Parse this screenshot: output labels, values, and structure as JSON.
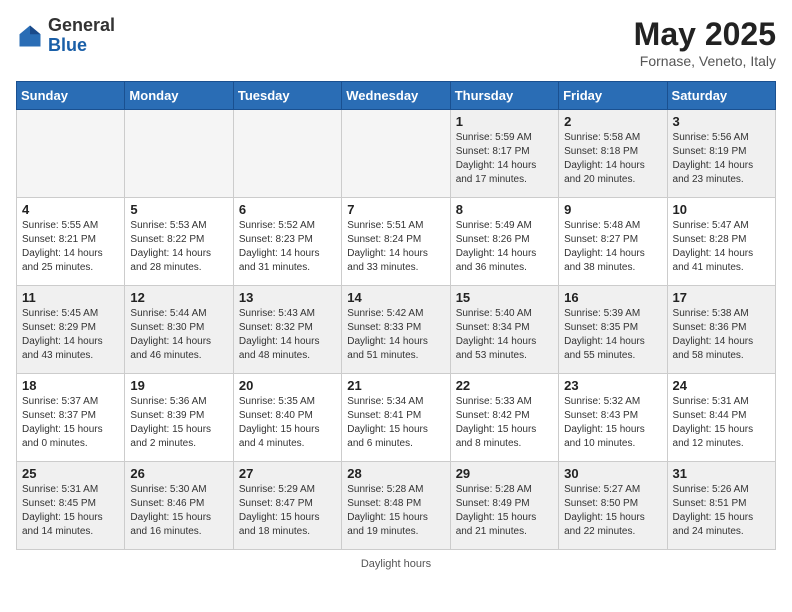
{
  "header": {
    "logo_line1": "General",
    "logo_line2": "Blue",
    "month": "May 2025",
    "location": "Fornase, Veneto, Italy"
  },
  "days_of_week": [
    "Sunday",
    "Monday",
    "Tuesday",
    "Wednesday",
    "Thursday",
    "Friday",
    "Saturday"
  ],
  "weeks": [
    [
      {
        "day": "",
        "info": "",
        "empty": true
      },
      {
        "day": "",
        "info": "",
        "empty": true
      },
      {
        "day": "",
        "info": "",
        "empty": true
      },
      {
        "day": "",
        "info": "",
        "empty": true
      },
      {
        "day": "1",
        "info": "Sunrise: 5:59 AM\nSunset: 8:17 PM\nDaylight: 14 hours\nand 17 minutes."
      },
      {
        "day": "2",
        "info": "Sunrise: 5:58 AM\nSunset: 8:18 PM\nDaylight: 14 hours\nand 20 minutes."
      },
      {
        "day": "3",
        "info": "Sunrise: 5:56 AM\nSunset: 8:19 PM\nDaylight: 14 hours\nand 23 minutes."
      }
    ],
    [
      {
        "day": "4",
        "info": "Sunrise: 5:55 AM\nSunset: 8:21 PM\nDaylight: 14 hours\nand 25 minutes."
      },
      {
        "day": "5",
        "info": "Sunrise: 5:53 AM\nSunset: 8:22 PM\nDaylight: 14 hours\nand 28 minutes."
      },
      {
        "day": "6",
        "info": "Sunrise: 5:52 AM\nSunset: 8:23 PM\nDaylight: 14 hours\nand 31 minutes."
      },
      {
        "day": "7",
        "info": "Sunrise: 5:51 AM\nSunset: 8:24 PM\nDaylight: 14 hours\nand 33 minutes."
      },
      {
        "day": "8",
        "info": "Sunrise: 5:49 AM\nSunset: 8:26 PM\nDaylight: 14 hours\nand 36 minutes."
      },
      {
        "day": "9",
        "info": "Sunrise: 5:48 AM\nSunset: 8:27 PM\nDaylight: 14 hours\nand 38 minutes."
      },
      {
        "day": "10",
        "info": "Sunrise: 5:47 AM\nSunset: 8:28 PM\nDaylight: 14 hours\nand 41 minutes."
      }
    ],
    [
      {
        "day": "11",
        "info": "Sunrise: 5:45 AM\nSunset: 8:29 PM\nDaylight: 14 hours\nand 43 minutes."
      },
      {
        "day": "12",
        "info": "Sunrise: 5:44 AM\nSunset: 8:30 PM\nDaylight: 14 hours\nand 46 minutes."
      },
      {
        "day": "13",
        "info": "Sunrise: 5:43 AM\nSunset: 8:32 PM\nDaylight: 14 hours\nand 48 minutes."
      },
      {
        "day": "14",
        "info": "Sunrise: 5:42 AM\nSunset: 8:33 PM\nDaylight: 14 hours\nand 51 minutes."
      },
      {
        "day": "15",
        "info": "Sunrise: 5:40 AM\nSunset: 8:34 PM\nDaylight: 14 hours\nand 53 minutes."
      },
      {
        "day": "16",
        "info": "Sunrise: 5:39 AM\nSunset: 8:35 PM\nDaylight: 14 hours\nand 55 minutes."
      },
      {
        "day": "17",
        "info": "Sunrise: 5:38 AM\nSunset: 8:36 PM\nDaylight: 14 hours\nand 58 minutes."
      }
    ],
    [
      {
        "day": "18",
        "info": "Sunrise: 5:37 AM\nSunset: 8:37 PM\nDaylight: 15 hours\nand 0 minutes."
      },
      {
        "day": "19",
        "info": "Sunrise: 5:36 AM\nSunset: 8:39 PM\nDaylight: 15 hours\nand 2 minutes."
      },
      {
        "day": "20",
        "info": "Sunrise: 5:35 AM\nSunset: 8:40 PM\nDaylight: 15 hours\nand 4 minutes."
      },
      {
        "day": "21",
        "info": "Sunrise: 5:34 AM\nSunset: 8:41 PM\nDaylight: 15 hours\nand 6 minutes."
      },
      {
        "day": "22",
        "info": "Sunrise: 5:33 AM\nSunset: 8:42 PM\nDaylight: 15 hours\nand 8 minutes."
      },
      {
        "day": "23",
        "info": "Sunrise: 5:32 AM\nSunset: 8:43 PM\nDaylight: 15 hours\nand 10 minutes."
      },
      {
        "day": "24",
        "info": "Sunrise: 5:31 AM\nSunset: 8:44 PM\nDaylight: 15 hours\nand 12 minutes."
      }
    ],
    [
      {
        "day": "25",
        "info": "Sunrise: 5:31 AM\nSunset: 8:45 PM\nDaylight: 15 hours\nand 14 minutes."
      },
      {
        "day": "26",
        "info": "Sunrise: 5:30 AM\nSunset: 8:46 PM\nDaylight: 15 hours\nand 16 minutes."
      },
      {
        "day": "27",
        "info": "Sunrise: 5:29 AM\nSunset: 8:47 PM\nDaylight: 15 hours\nand 18 minutes."
      },
      {
        "day": "28",
        "info": "Sunrise: 5:28 AM\nSunset: 8:48 PM\nDaylight: 15 hours\nand 19 minutes."
      },
      {
        "day": "29",
        "info": "Sunrise: 5:28 AM\nSunset: 8:49 PM\nDaylight: 15 hours\nand 21 minutes."
      },
      {
        "day": "30",
        "info": "Sunrise: 5:27 AM\nSunset: 8:50 PM\nDaylight: 15 hours\nand 22 minutes."
      },
      {
        "day": "31",
        "info": "Sunrise: 5:26 AM\nSunset: 8:51 PM\nDaylight: 15 hours\nand 24 minutes."
      }
    ]
  ],
  "footer": "Daylight hours"
}
